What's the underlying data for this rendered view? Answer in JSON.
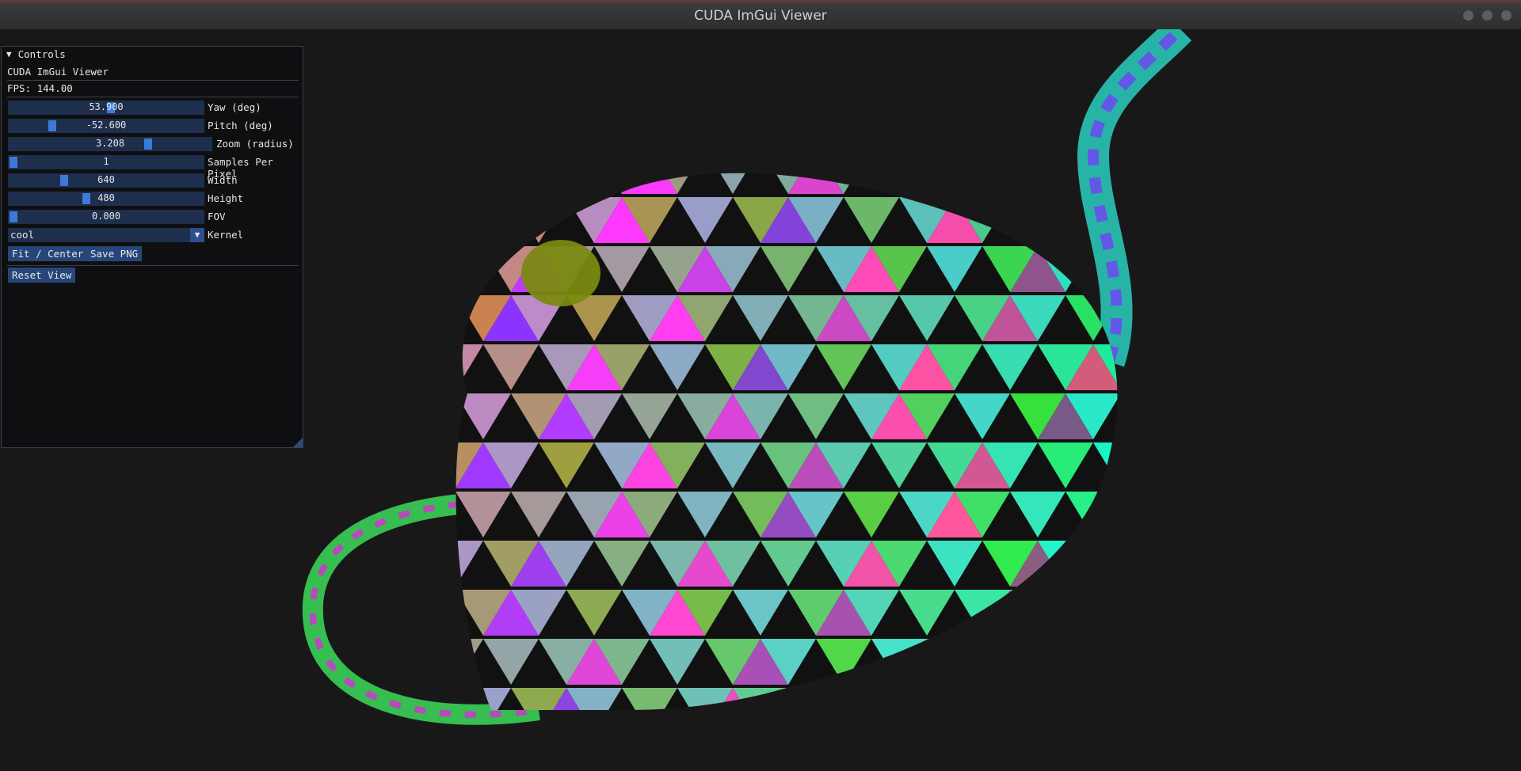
{
  "window": {
    "title": "CUDA ImGui Viewer"
  },
  "panel": {
    "header": "Controls",
    "app_name": "CUDA ImGui Viewer",
    "fps": "FPS: 144.00",
    "sliders": [
      {
        "label": "Yaw (deg)",
        "value": "53.900"
      },
      {
        "label": "Pitch (deg)",
        "value": "-52.600"
      },
      {
        "label": "Zoom (radius)",
        "value": "3.208"
      },
      {
        "label": "Samples Per Pixel",
        "value": "1"
      },
      {
        "label": "Width",
        "value": "640"
      },
      {
        "label": "Height",
        "value": "480"
      },
      {
        "label": "FOV",
        "value": "0.000"
      }
    ],
    "kernel": {
      "label": "Kernel",
      "value": "cool"
    },
    "buttons": {
      "fit": "Fit / Center",
      "save": "Save PNG",
      "reset": "Reset View"
    }
  },
  "colors": {
    "accent": "#3d7ad6",
    "frame": "#1e2e4d",
    "button": "#26467a"
  }
}
